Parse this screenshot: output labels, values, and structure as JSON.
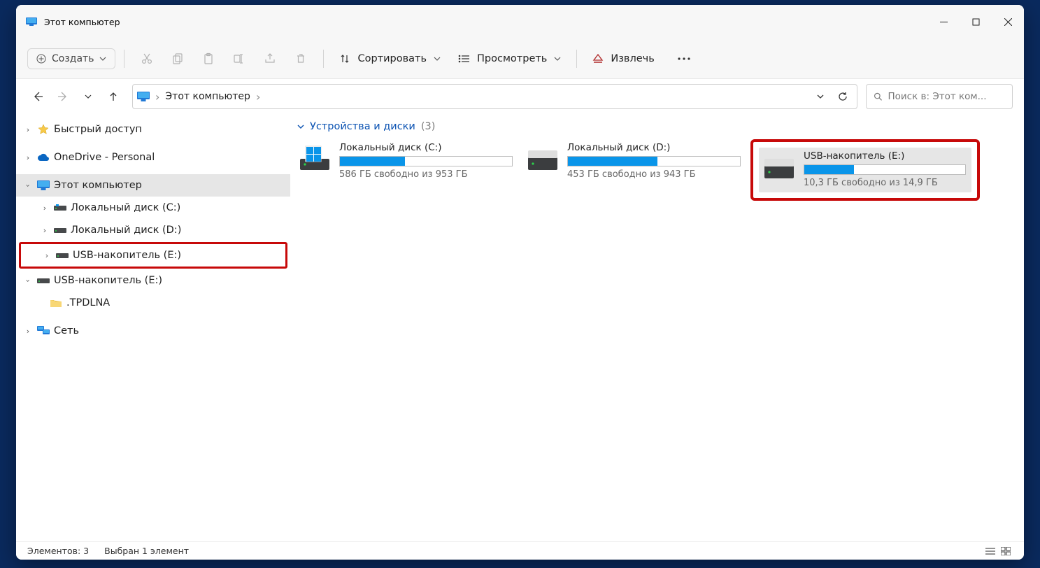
{
  "window": {
    "title": "Этот компьютер"
  },
  "toolbar": {
    "new_label": "Создать",
    "sort_label": "Сортировать",
    "view_label": "Просмотреть",
    "eject_label": "Извлечь"
  },
  "address": {
    "location": "Этот компьютер"
  },
  "search": {
    "placeholder": "Поиск в: Этот ком..."
  },
  "sidebar": {
    "quick_access": "Быстрый доступ",
    "onedrive": "OneDrive - Personal",
    "this_pc": "Этот компьютер",
    "disk_c": "Локальный диск (C:)",
    "disk_d": "Локальный диск (D:)",
    "usb_e": "USB-накопитель (E:)",
    "usb_e_2": "USB-накопитель (E:)",
    "tpdlna": ".TPDLNA",
    "network": "Сеть"
  },
  "group": {
    "heading": "Устройства и диски",
    "count": "(3)"
  },
  "drives": [
    {
      "name": "Локальный диск (C:)",
      "free": "586 ГБ свободно из 953 ГБ",
      "fill_pct": 38
    },
    {
      "name": "Локальный диск (D:)",
      "free": "453 ГБ свободно из 943 ГБ",
      "fill_pct": 52
    },
    {
      "name": "USB-накопитель (E:)",
      "free": "10,3 ГБ свободно из 14,9 ГБ",
      "fill_pct": 31
    }
  ],
  "status": {
    "left": "Элементов: 3",
    "right": "Выбран 1 элемент"
  }
}
